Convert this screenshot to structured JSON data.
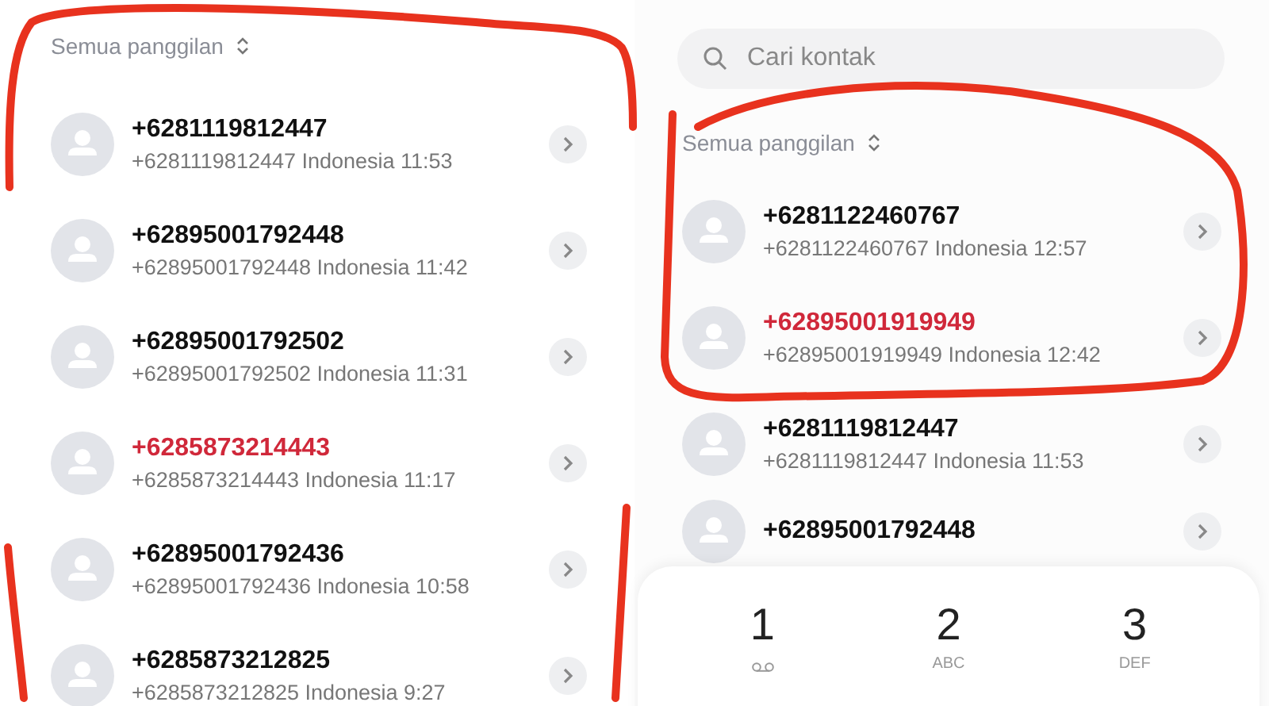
{
  "left": {
    "filter": "Semua panggilan",
    "calls": [
      {
        "number": "+6281119812447",
        "detail": "+6281119812447 Indonesia 11:53",
        "missed": false
      },
      {
        "number": "+62895001792448",
        "detail": "+62895001792448 Indonesia 11:42",
        "missed": false
      },
      {
        "number": "+62895001792502",
        "detail": "+62895001792502 Indonesia 11:31",
        "missed": false
      },
      {
        "number": "+6285873214443",
        "detail": "+6285873214443 Indonesia 11:17",
        "missed": true
      },
      {
        "number": "+62895001792436",
        "detail": "+62895001792436 Indonesia 10:58",
        "missed": false
      },
      {
        "number": "+6285873212825",
        "detail": "+6285873212825 Indonesia 9:27",
        "missed": false
      }
    ]
  },
  "right": {
    "search": {
      "placeholder": "Cari kontak"
    },
    "filter": "Semua panggilan",
    "calls": [
      {
        "number": "+6281122460767",
        "detail": "+6281122460767 Indonesia 12:57",
        "missed": false
      },
      {
        "number": "+62895001919949",
        "detail": "+62895001919949 Indonesia 12:42",
        "missed": true
      },
      {
        "number": "+6281119812447",
        "detail": "+6281119812447 Indonesia 11:53",
        "missed": false
      },
      {
        "number": "+62895001792448",
        "missed": false
      }
    ],
    "dialpad": [
      {
        "digit": "1",
        "kind": "voicemail"
      },
      {
        "digit": "2",
        "kind": "letters",
        "letters": "ABC"
      },
      {
        "digit": "3",
        "kind": "letters",
        "letters": "DEF"
      }
    ]
  }
}
